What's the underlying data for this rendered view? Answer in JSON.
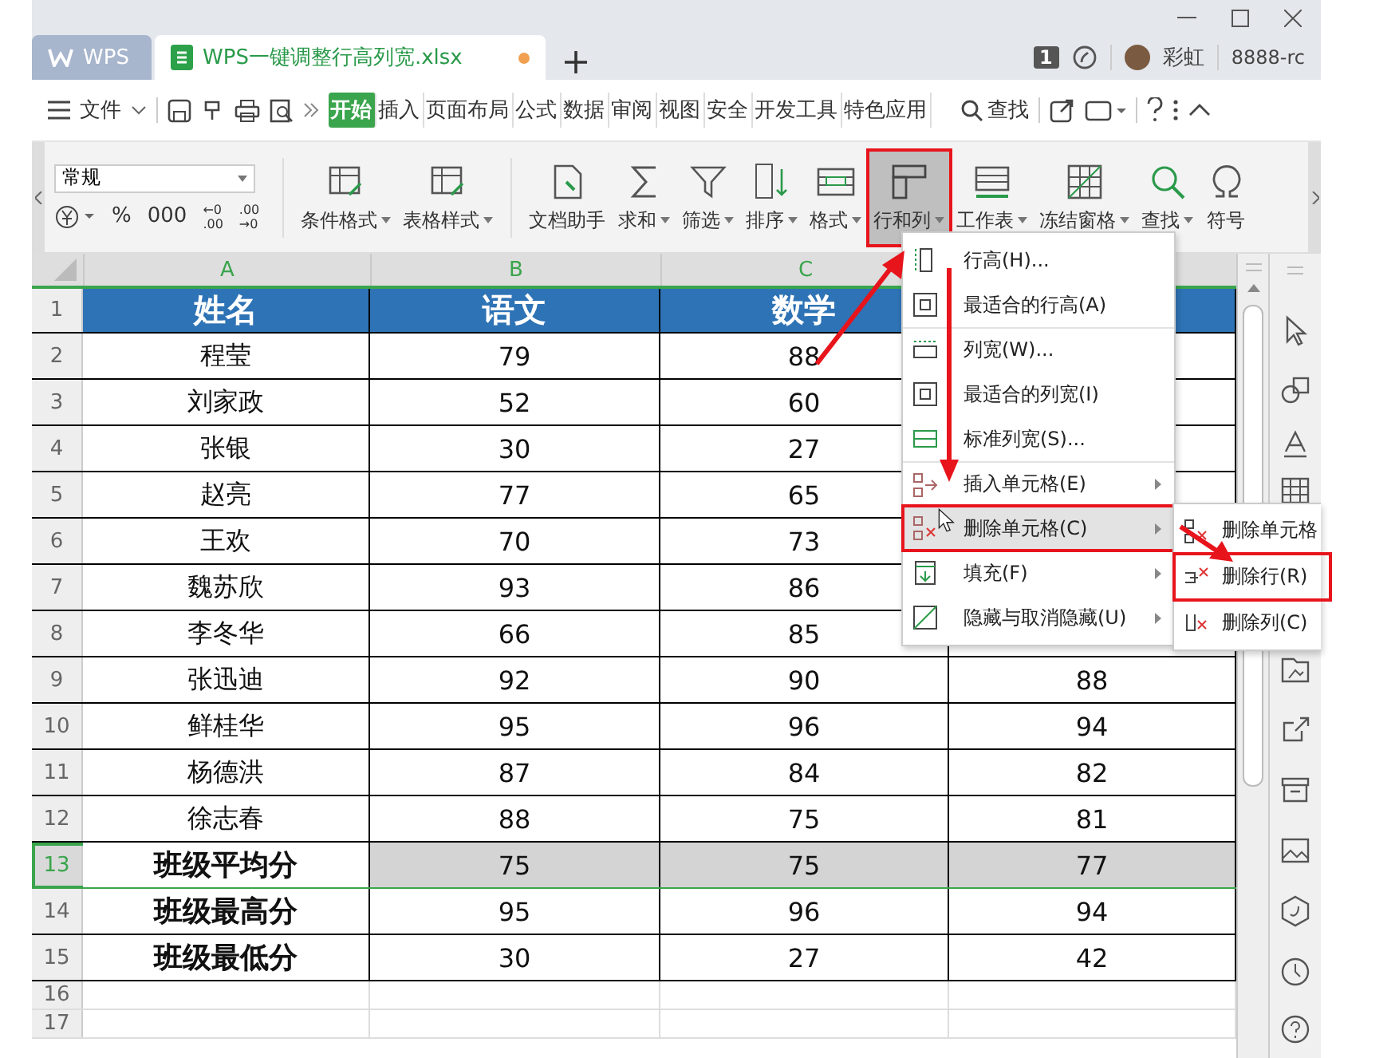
{
  "titlebar": {
    "tabs": [
      {
        "label": "WPS",
        "kind": "home",
        "selected": false
      },
      {
        "label": "WPS一键调整行高列宽.xlsx",
        "kind": "sheet",
        "selected": true
      }
    ],
    "badge": "1",
    "user_name": "彩虹",
    "account": "8888-rc"
  },
  "menubar": {
    "file": "文件",
    "tabs": [
      {
        "label": "开始",
        "selected": true
      },
      {
        "label": "插入",
        "selected": false
      },
      {
        "label": "页面布局",
        "selected": false
      },
      {
        "label": "公式",
        "selected": false
      },
      {
        "label": "数据",
        "selected": false
      },
      {
        "label": "审阅",
        "selected": false
      },
      {
        "label": "视图",
        "selected": false
      },
      {
        "label": "安全",
        "selected": false
      },
      {
        "label": "开发工具",
        "selected": false
      },
      {
        "label": "特色应用",
        "selected": false
      }
    ],
    "search": "查找"
  },
  "ribbon": {
    "number_format": "常规",
    "number_buttons": [
      {
        "kind": "currency"
      },
      {
        "kind": "text",
        "label": "%"
      },
      {
        "kind": "text",
        "label": "000"
      },
      {
        "kind": "stack",
        "top": "←0",
        "bottom": ".00"
      },
      {
        "kind": "stack",
        "top": ".00",
        "bottom": "→0"
      }
    ],
    "buttons": [
      {
        "label": "条件格式",
        "dropdown": true,
        "selected": false,
        "annotated": false
      },
      {
        "label": "表格样式",
        "dropdown": true,
        "selected": false,
        "annotated": false
      },
      {
        "label": "文档助手",
        "dropdown": false,
        "selected": false,
        "annotated": false
      },
      {
        "label": "求和",
        "dropdown": true,
        "selected": false,
        "annotated": false
      },
      {
        "label": "筛选",
        "dropdown": true,
        "selected": false,
        "annotated": false
      },
      {
        "label": "排序",
        "dropdown": true,
        "selected": false,
        "annotated": false
      },
      {
        "label": "格式",
        "dropdown": true,
        "selected": false,
        "annotated": false
      },
      {
        "label": "行和列",
        "dropdown": true,
        "selected": true,
        "annotated": true
      },
      {
        "label": "工作表",
        "dropdown": true,
        "selected": false,
        "annotated": false
      },
      {
        "label": "冻结窗格",
        "dropdown": true,
        "selected": false,
        "annotated": false
      },
      {
        "label": "查找",
        "dropdown": true,
        "selected": false,
        "annotated": false
      },
      {
        "label": "符号",
        "dropdown": false,
        "selected": false,
        "annotated": false
      }
    ]
  },
  "sheet": {
    "columns": [
      "A",
      "B",
      "C"
    ],
    "rows": [
      {
        "num": "1",
        "kind": "header",
        "selected": false,
        "cells": [
          "姓名",
          "语文",
          "数学"
        ]
      },
      {
        "num": "2",
        "kind": "data",
        "selected": false,
        "cells": [
          "程莹",
          "79",
          "88"
        ]
      },
      {
        "num": "3",
        "kind": "data",
        "selected": false,
        "cells": [
          "刘家政",
          "52",
          "60"
        ]
      },
      {
        "num": "4",
        "kind": "data",
        "selected": false,
        "cells": [
          "张银",
          "30",
          "27"
        ]
      },
      {
        "num": "5",
        "kind": "data",
        "selected": false,
        "cells": [
          "赵亮",
          "77",
          "65"
        ]
      },
      {
        "num": "6",
        "kind": "data",
        "selected": false,
        "cells": [
          "王欢",
          "70",
          "73"
        ]
      },
      {
        "num": "7",
        "kind": "data",
        "selected": false,
        "cells": [
          "魏苏欣",
          "93",
          "86"
        ]
      },
      {
        "num": "8",
        "kind": "data",
        "selected": false,
        "cells": [
          "李冬华",
          "66",
          "85"
        ]
      },
      {
        "num": "9",
        "kind": "data",
        "selected": false,
        "cells": [
          "张迅迪",
          "92",
          "90",
          "88"
        ]
      },
      {
        "num": "10",
        "kind": "data",
        "selected": false,
        "cells": [
          "鲜桂华",
          "95",
          "96",
          "94"
        ]
      },
      {
        "num": "11",
        "kind": "data",
        "selected": false,
        "cells": [
          "杨德洪",
          "87",
          "84",
          "82"
        ]
      },
      {
        "num": "12",
        "kind": "data",
        "selected": false,
        "cells": [
          "徐志春",
          "88",
          "75",
          "81"
        ]
      },
      {
        "num": "13",
        "kind": "summary",
        "selected": true,
        "cells": [
          "班级平均分",
          "75",
          "75",
          "77"
        ]
      },
      {
        "num": "14",
        "kind": "summary",
        "selected": false,
        "cells": [
          "班级最高分",
          "95",
          "96",
          "94"
        ]
      },
      {
        "num": "15",
        "kind": "summary",
        "selected": false,
        "cells": [
          "班级最低分",
          "30",
          "27",
          "42"
        ]
      },
      {
        "num": "16",
        "kind": "empty",
        "selected": false,
        "cells": []
      },
      {
        "num": "17",
        "kind": "empty",
        "selected": false,
        "cells": []
      }
    ]
  },
  "menu": {
    "groups": [
      [
        {
          "label": "行高(H)...",
          "submenu": false,
          "highlighted": false,
          "annotated": false
        },
        {
          "label": "最适合的行高(A)",
          "submenu": false,
          "highlighted": false,
          "annotated": false
        }
      ],
      [
        {
          "label": "列宽(W)...",
          "submenu": false,
          "highlighted": false,
          "annotated": false
        },
        {
          "label": "最适合的列宽(I)",
          "submenu": false,
          "highlighted": false,
          "annotated": false
        },
        {
          "label": "标准列宽(S)...",
          "submenu": false,
          "highlighted": false,
          "annotated": false
        }
      ],
      [
        {
          "label": "插入单元格(E)",
          "submenu": true,
          "highlighted": false,
          "annotated": false
        },
        {
          "label": "删除单元格(C)",
          "submenu": true,
          "highlighted": true,
          "annotated": true
        },
        {
          "label": "填充(F)",
          "submenu": true,
          "highlighted": false,
          "annotated": false
        },
        {
          "label": "隐藏与取消隐藏(U)",
          "submenu": true,
          "highlighted": false,
          "annotated": false
        }
      ]
    ]
  },
  "submenu": {
    "items": [
      {
        "label": "删除单元格",
        "annotated": false
      },
      {
        "label": "删除行(R)",
        "annotated": true
      },
      {
        "label": "删除列(C)",
        "annotated": false
      }
    ]
  }
}
